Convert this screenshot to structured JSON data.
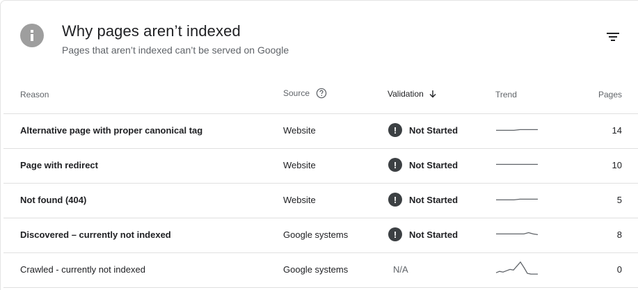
{
  "header": {
    "title": "Why pages aren’t indexed",
    "subtitle": "Pages that aren’t indexed can’t be served on Google",
    "info_icon": "info-icon",
    "filter_icon": "filter-list-icon"
  },
  "table": {
    "columns": {
      "reason": "Reason",
      "source": "Source",
      "validation": "Validation",
      "trend": "Trend",
      "pages": "Pages"
    },
    "sort": {
      "column": "Validation",
      "direction": "descending"
    },
    "rows": [
      {
        "reason": "Alternative page with proper canonical tag",
        "source": "Website",
        "validation": "Not Started",
        "validation_icon": "exclamation-icon",
        "pages": "14",
        "trend": [
          0.45,
          0.45,
          0.45,
          0.45,
          0.5,
          0.5,
          0.5,
          0.5
        ],
        "bold": true
      },
      {
        "reason": "Page with redirect",
        "source": "Website",
        "validation": "Not Started",
        "validation_icon": "exclamation-icon",
        "pages": "10",
        "trend": [
          0.5,
          0.5,
          0.5,
          0.5,
          0.5,
          0.5,
          0.5,
          0.5
        ],
        "bold": true
      },
      {
        "reason": "Not found (404)",
        "source": "Website",
        "validation": "Not Started",
        "validation_icon": "exclamation-icon",
        "pages": "5",
        "trend": [
          0.45,
          0.45,
          0.45,
          0.45,
          0.5,
          0.5,
          0.5,
          0.5
        ],
        "bold": true
      },
      {
        "reason": "Discovered – currently not indexed",
        "source": "Google systems",
        "validation": "Not Started",
        "validation_icon": "exclamation-icon",
        "pages": "8",
        "trend": [
          0.5,
          0.5,
          0.5,
          0.5,
          0.5,
          0.5,
          0.5,
          0.6,
          0.5,
          0.45
        ],
        "bold": true
      },
      {
        "reason": "Crawled - currently not indexed",
        "source": "Google systems",
        "validation": "N/A",
        "validation_icon": "",
        "pages": "0",
        "trend": [
          0.2,
          0.3,
          0.25,
          0.35,
          0.45,
          0.4,
          0.7,
          1.0,
          0.6,
          0.15,
          0.1,
          0.1,
          0.1
        ],
        "bold": false
      }
    ]
  },
  "colors": {
    "text": "#202124",
    "secondary": "#5f6368",
    "divider": "#e0e0e0",
    "info_circle": "#9e9e9e",
    "status_icon": "#3c4043",
    "sparkline": "#5f6368"
  }
}
